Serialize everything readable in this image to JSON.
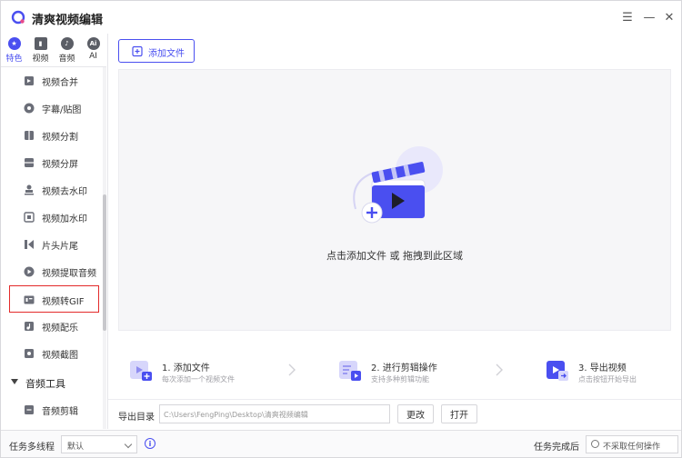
{
  "app": {
    "title": "清爽视频编辑"
  },
  "window_controls": {
    "menu": "☰",
    "minimize": "—",
    "close": "✕"
  },
  "category_tabs": [
    {
      "label": "特色",
      "icon": "star-icon",
      "active": true
    },
    {
      "label": "视频",
      "icon": "film-icon",
      "active": false
    },
    {
      "label": "音频",
      "icon": "music-icon",
      "active": false
    },
    {
      "label": "AI",
      "icon": "ai-icon",
      "active": false
    }
  ],
  "sidebar": {
    "items": [
      {
        "label": "视频合并",
        "icon": "merge-icon"
      },
      {
        "label": "字幕/贴图",
        "icon": "sticker-icon"
      },
      {
        "label": "视频分割",
        "icon": "split-icon"
      },
      {
        "label": "视频分屏",
        "icon": "splitscreen-icon"
      },
      {
        "label": "视频去水印",
        "icon": "stamp-icon"
      },
      {
        "label": "视频加水印",
        "icon": "watermark-icon"
      },
      {
        "label": "片头片尾",
        "icon": "intro-outro-icon"
      },
      {
        "label": "视频提取音频",
        "icon": "extract-audio-icon"
      },
      {
        "label": "视频转GIF",
        "icon": "gif-icon",
        "selected": true
      },
      {
        "label": "视频配乐",
        "icon": "soundtrack-icon"
      },
      {
        "label": "视频截图",
        "icon": "screenshot-icon"
      }
    ],
    "group": {
      "label": "音频工具"
    },
    "group_items": [
      {
        "label": "音频剪辑",
        "icon": "audio-cut-icon"
      }
    ]
  },
  "main": {
    "add_file_label": "添加文件",
    "drop_text": "点击添加文件 或 拖拽到此区域",
    "steps": [
      {
        "title": "1. 添加文件",
        "subtitle": "每次添加一个视频文件"
      },
      {
        "title": "2. 进行剪辑操作",
        "subtitle": "支持多种剪辑功能"
      },
      {
        "title": "3. 导出视频",
        "subtitle": "点击按钮开始导出"
      }
    ],
    "export": {
      "label": "导出目录",
      "path": "C:\\Users\\FengPing\\Desktop\\清爽视频编辑",
      "change_label": "更改",
      "open_label": "打开"
    }
  },
  "statusbar": {
    "threads_label": "任务多线程",
    "threads_value": "默认",
    "after_label": "任务完成后",
    "after_value": "不采取任何操作"
  },
  "colors": {
    "accent": "#4a4ff0",
    "selected_border": "#e32a2a",
    "drop_bg": "#f6f6f8"
  }
}
